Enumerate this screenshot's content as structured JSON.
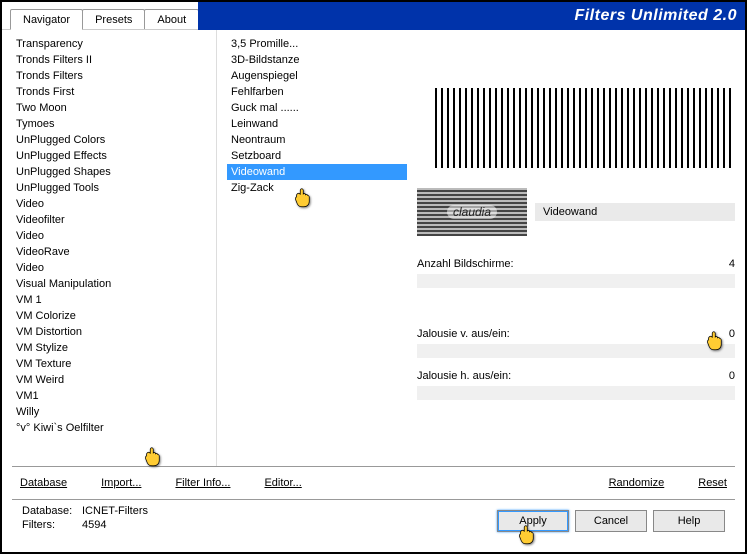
{
  "title": "Filters Unlimited 2.0",
  "tabs": {
    "navigator": "Navigator",
    "presets": "Presets",
    "about": "About"
  },
  "leftList": [
    "Transparency",
    "Tronds Filters II",
    "Tronds Filters",
    "Tronds First",
    "Two Moon",
    "Tymoes",
    "UnPlugged Colors",
    "UnPlugged Effects",
    "UnPlugged Shapes",
    "UnPlugged Tools",
    "Video",
    "Videofilter",
    "Video",
    "VideoRave",
    "Video",
    "Visual Manipulation",
    "VM 1",
    "VM Colorize",
    "VM Distortion",
    "VM Stylize",
    "VM Texture",
    "VM Weird",
    "VM1",
    "Willy",
    "°v° Kiwi`s Oelfilter"
  ],
  "leftSelectedIndex": 24,
  "midList": [
    "3,5 Promille...",
    "3D-Bildstanze",
    "Augenspiegel",
    "Fehlfarben",
    "Guck mal ......",
    "Leinwand",
    "Neontraum",
    "Setzboard",
    "Videowand",
    "Zig-Zack"
  ],
  "midSelectedIndex": 8,
  "preview": {
    "name": "Videowand",
    "badge": "claudia"
  },
  "params": [
    {
      "label": "Anzahl Bildschirme:",
      "value": "4"
    },
    {
      "label": "Jalousie v. aus/ein:",
      "value": "0"
    },
    {
      "label": "Jalousie h. aus/ein:",
      "value": "0"
    }
  ],
  "actions": {
    "database": "Database",
    "import": "Import...",
    "filterInfo": "Filter Info...",
    "editor": "Editor...",
    "randomize": "Randomize",
    "reset": "Reset"
  },
  "footer": {
    "dbLabel": "Database:",
    "dbValue": "ICNET-Filters",
    "filtersLabel": "Filters:",
    "filtersValue": "4594",
    "apply": "Apply",
    "cancel": "Cancel",
    "help": "Help"
  }
}
